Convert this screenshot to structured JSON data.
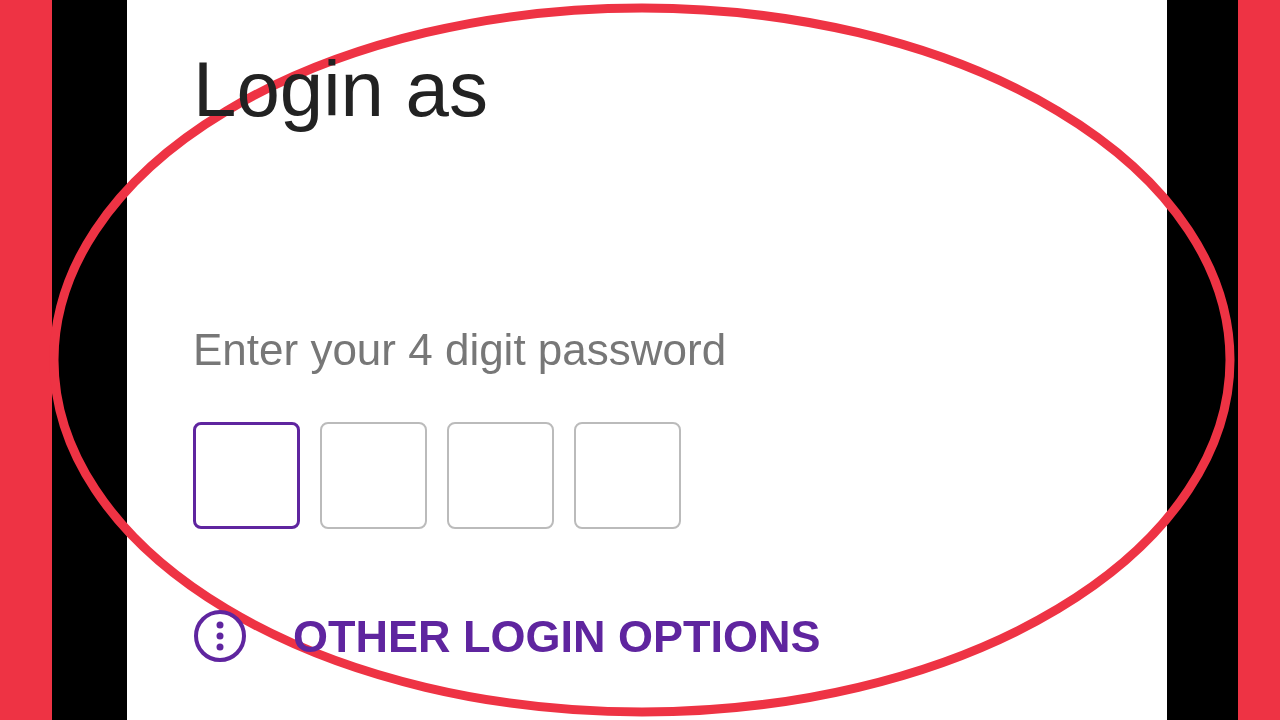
{
  "title": "Login as",
  "password_label": "Enter your 4 digit password",
  "pin_boxes": [
    {
      "selected": true
    },
    {
      "selected": false
    },
    {
      "selected": false
    },
    {
      "selected": false
    }
  ],
  "other_options": {
    "label": "OTHER LOGIN OPTIONS"
  }
}
